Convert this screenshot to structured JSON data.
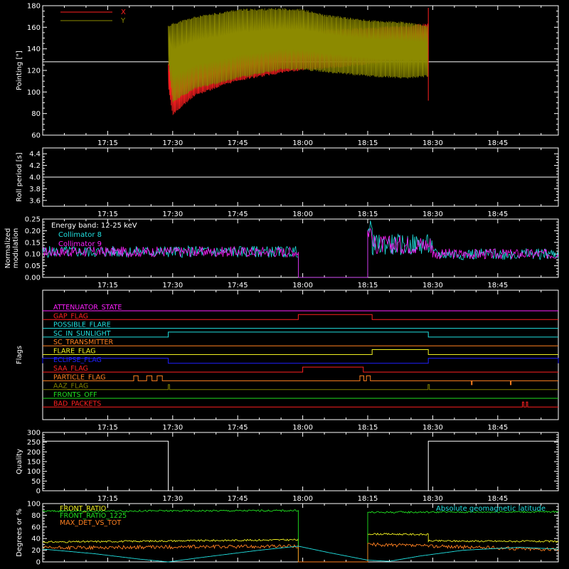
{
  "time_ticks": [
    "17:15",
    "17:30",
    "17:45",
    "18:00",
    "18:15",
    "18:30",
    "18:45"
  ],
  "colors": {
    "background": "#000000",
    "axis": "#ffffff",
    "red": "#ff2020",
    "olive": "#8c8a00",
    "white": "#ffffff",
    "magenta": "#ff20ff",
    "cyan": "#20e0e0",
    "yellow": "#f0f020",
    "orange": "#ff8020",
    "blue": "#2020ff",
    "green": "#20e020",
    "dark_olive": "#808000"
  },
  "chart_data": [
    {
      "type": "line",
      "name": "pointing",
      "ylabel": "Pointing [\"]",
      "ylim": [
        60,
        180
      ],
      "yticks": [
        "60",
        "80",
        "100",
        "120",
        "140",
        "160",
        "180"
      ],
      "legend": [
        {
          "name": "X",
          "color": "#ff2020"
        },
        {
          "name": "Y",
          "color": "#8c8a00"
        }
      ],
      "reference_line": 128,
      "envelope_x_upper": [
        [
          17.483,
          125
        ],
        [
          17.5,
          132
        ],
        [
          17.583,
          140
        ],
        [
          17.75,
          149
        ],
        [
          17.917,
          154
        ],
        [
          18.083,
          156
        ],
        [
          18.25,
          158
        ],
        [
          18.4,
          160
        ],
        [
          18.483,
          162
        ]
      ],
      "envelope_x_lower": [
        [
          17.483,
          105
        ],
        [
          17.5,
          80
        ],
        [
          17.583,
          98
        ],
        [
          17.75,
          112
        ],
        [
          17.917,
          119
        ],
        [
          18.0,
          122
        ],
        [
          18.083,
          123
        ],
        [
          18.25,
          127
        ],
        [
          18.4,
          132
        ],
        [
          18.483,
          136
        ]
      ],
      "envelope_y_upper": [
        [
          17.483,
          160
        ],
        [
          17.5,
          162
        ],
        [
          17.583,
          168
        ],
        [
          17.75,
          175
        ],
        [
          17.917,
          176
        ],
        [
          18.0,
          175
        ],
        [
          18.083,
          170
        ],
        [
          18.25,
          165
        ],
        [
          18.4,
          163
        ],
        [
          18.483,
          160
        ]
      ],
      "envelope_y_lower": [
        [
          17.483,
          130
        ],
        [
          17.5,
          92
        ],
        [
          17.583,
          104
        ],
        [
          17.75,
          114
        ],
        [
          17.917,
          122
        ],
        [
          18.0,
          122
        ],
        [
          18.083,
          120
        ],
        [
          18.25,
          116
        ],
        [
          18.4,
          114
        ],
        [
          18.483,
          116
        ]
      ]
    },
    {
      "type": "line",
      "name": "roll-period",
      "ylabel": "Roll period [s]",
      "ylim": [
        3.5,
        4.5
      ],
      "yticks": [
        "3.6",
        "3.8",
        "4.0",
        "4.2",
        "4.4"
      ],
      "value": 4.0
    },
    {
      "type": "line",
      "name": "modulation",
      "ylabel": "Normalized modulation",
      "ylim": [
        0,
        0.25
      ],
      "yticks": [
        "0.00",
        "0.05",
        "0.10",
        "0.15",
        "0.20",
        "0.25"
      ],
      "annotation": "Energy band: 12-25 keV",
      "legend": [
        {
          "name": "Collimator 8",
          "color": "#20e0e0"
        },
        {
          "name": "Collimator 9",
          "color": "#ff20ff"
        }
      ],
      "segments": [
        {
          "start": 17.0,
          "end": 17.983,
          "level": 0.11
        },
        {
          "start": 17.983,
          "end": 18.25,
          "level": 0.0
        },
        {
          "start": 18.25,
          "end": 18.267,
          "level": 0.2
        },
        {
          "start": 18.267,
          "end": 18.5,
          "level": 0.14
        },
        {
          "start": 18.5,
          "end": 18.983,
          "level": 0.1
        }
      ]
    },
    {
      "type": "line",
      "name": "flags",
      "ylabel": "Flags",
      "flags": [
        {
          "label": "ATTENUATOR_STATE",
          "color": "#ff20ff",
          "transitions": []
        },
        {
          "label": "GAP_FLAG",
          "color": "#ff2020",
          "transitions": [
            [
              17.983,
              18.267
            ]
          ]
        },
        {
          "label": "POSSIBLE_FLARE",
          "color": "#20e0e0",
          "transitions": []
        },
        {
          "label": "SC_IN_SUNLIGHT",
          "color": "#20e0e0",
          "transitions": [
            [
              17.483,
              18.483
            ]
          ]
        },
        {
          "label": "SC_TRANSMITTER",
          "color": "#ff8020",
          "transitions": []
        },
        {
          "label": "FLARE_FLAG",
          "color": "#f0f020",
          "transitions": [
            [
              18.267,
              18.483
            ]
          ]
        },
        {
          "label": "ECLIPSE_FLAG",
          "color": "#2020ff",
          "transitions": [
            [
              17.0,
              17.483
            ],
            [
              18.483,
              18.983
            ]
          ]
        },
        {
          "label": "SAA_FLAG",
          "color": "#ff2020",
          "transitions": [
            [
              18.0,
              18.233
            ]
          ]
        },
        {
          "label": "PARTICLE_FLAG",
          "color": "#ff8020",
          "transitions": [
            [
              17.35,
              17.367
            ],
            [
              17.4,
              17.42
            ],
            [
              17.44,
              17.46
            ],
            [
              18.22,
              18.235
            ],
            [
              18.245,
              18.26
            ]
          ]
        },
        {
          "label": "AAZ_FLAG",
          "color": "#808000",
          "transitions": [
            [
              17.483,
              17.488
            ],
            [
              18.482,
              18.487
            ]
          ]
        },
        {
          "label": "FRONTS_OFF",
          "color": "#20e020",
          "transitions": []
        },
        {
          "label": "BAD_PACKETS",
          "color": "#ff2020",
          "transitions": [
            [
              18.845,
              18.85
            ],
            [
              18.86,
              18.865
            ]
          ]
        }
      ]
    },
    {
      "type": "line",
      "name": "quality",
      "ylabel": "Quality",
      "ylim": [
        0,
        300
      ],
      "yticks": [
        "0",
        "50",
        "100",
        "150",
        "200",
        "250",
        "300"
      ],
      "points": [
        [
          17.0,
          255
        ],
        [
          17.483,
          255
        ],
        [
          17.483,
          0
        ],
        [
          18.483,
          0
        ],
        [
          18.483,
          255
        ],
        [
          18.983,
          255
        ]
      ]
    },
    {
      "type": "line",
      "name": "degrees",
      "ylabel": "Degrees or %",
      "ylim": [
        0,
        100
      ],
      "yticks": [
        "0",
        "20",
        "40",
        "60",
        "80",
        "100"
      ],
      "annotation": "Absolute geomagnetic latitude",
      "legend": [
        {
          "name": "FRONT_RATIO",
          "color": "#f0f020"
        },
        {
          "name": "FRONT_RATIO_1225",
          "color": "#20e020"
        },
        {
          "name": "MAX_DET_VS_TOT",
          "color": "#ff8020"
        }
      ],
      "series": [
        {
          "name": "FRONT_RATIO",
          "color": "#f0f020",
          "points": [
            [
              17.0,
              34
            ],
            [
              17.983,
              38
            ],
            [
              17.983,
              0
            ],
            [
              18.25,
              0
            ],
            [
              18.25,
              48
            ],
            [
              18.483,
              47
            ],
            [
              18.483,
              36
            ],
            [
              18.983,
              35
            ]
          ]
        },
        {
          "name": "FRONT_RATIO_1225",
          "color": "#20e020",
          "points": [
            [
              17.0,
              87
            ],
            [
              17.983,
              88
            ],
            [
              17.983,
              0
            ],
            [
              18.25,
              0
            ],
            [
              18.25,
              85
            ],
            [
              18.983,
              86
            ]
          ]
        },
        {
          "name": "MAX_DET_VS_TOT",
          "color": "#ff8020",
          "points": [
            [
              17.0,
              24
            ],
            [
              17.983,
              27
            ],
            [
              17.983,
              0
            ],
            [
              18.25,
              0
            ],
            [
              18.25,
              30
            ],
            [
              18.983,
              21
            ]
          ]
        },
        {
          "name": "Absolute geomagnetic latitude",
          "color": "#20e0e0",
          "points": [
            [
              17.0,
              22
            ],
            [
              17.2,
              14
            ],
            [
              17.367,
              5
            ],
            [
              17.483,
              0
            ],
            [
              17.6,
              7
            ],
            [
              17.833,
              20
            ],
            [
              17.983,
              27
            ],
            [
              18.1,
              16
            ],
            [
              18.25,
              3
            ],
            [
              18.333,
              1
            ],
            [
              18.45,
              10
            ],
            [
              18.617,
              20
            ],
            [
              18.833,
              25
            ],
            [
              18.983,
              22
            ]
          ]
        }
      ]
    }
  ]
}
